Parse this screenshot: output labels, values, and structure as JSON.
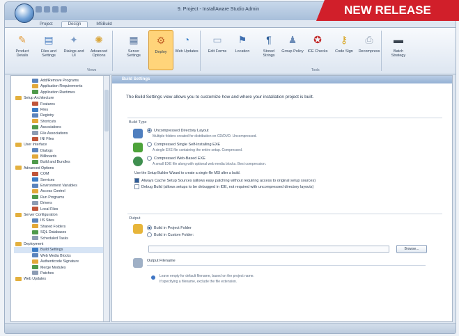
{
  "banner": {
    "bold": "NEW",
    "rest": " RELEASE"
  },
  "window": {
    "title": "9. Project - InstallAware Studio Admin"
  },
  "ribbon_tabs": [
    "Project",
    "Design",
    "MSBuild"
  ],
  "ribbon": {
    "buttons": [
      {
        "label": "Product Details",
        "icon": "product-details-icon",
        "color": "#e39b3a"
      },
      {
        "label": "Files and Settings",
        "icon": "files-icon",
        "color": "#4c7fc0"
      },
      {
        "label": "Dialogs and UI",
        "icon": "dialogs-icon",
        "color": "#7c9cc6"
      },
      {
        "label": "Advanced Options",
        "icon": "advanced-icon",
        "color": "#d9a53a"
      },
      {
        "label": "Server Settings",
        "icon": "server-icon",
        "color": "#5d7aa3"
      },
      {
        "label": "Deploy",
        "icon": "deploy-icon",
        "color": "#c4642a",
        "active": true
      },
      {
        "label": "Web Updates",
        "icon": "web-updates-icon",
        "color": "#3b80c8"
      },
      {
        "label": "Edit Forms",
        "icon": "edit-forms-icon",
        "color": "#8aa2c2"
      },
      {
        "label": "Location",
        "icon": "location-icon",
        "color": "#3f6fb0"
      },
      {
        "label": "Stored Strings",
        "icon": "strings-icon",
        "color": "#2e5f99"
      },
      {
        "label": "Group Policy",
        "icon": "group-policy-icon",
        "color": "#6b8bb7"
      },
      {
        "label": "ICE Checks",
        "icon": "ice-checks-icon",
        "color": "#c22c2c"
      },
      {
        "label": "Code Sign",
        "icon": "code-sign-icon",
        "color": "#d7a21c"
      },
      {
        "label": "Decompress",
        "icon": "decompress-icon",
        "color": "#9aa7b8"
      },
      {
        "label": "Batch Strategy",
        "icon": "batch-icon",
        "color": "#3a4450"
      }
    ],
    "groups": [
      "Views",
      "Tools"
    ]
  },
  "tree": [
    "Add/Remove Programs",
    "Application Requirements",
    "Application Runtimes",
    "Setup Architecture",
    "Features",
    "Files",
    "Registry",
    "Shortcuts",
    "Associations",
    "File Associations",
    "INI Files",
    "User Interface",
    "Dialogs",
    "Billboards",
    "Build and Bundles",
    "Advanced Options",
    "COM",
    "Services",
    "Environment Variables",
    "Access Control",
    "Run Programs",
    "Drivers",
    "Local Files",
    "Server Configuration",
    "IIS Sites",
    "Shared Folders",
    "SQL Databases",
    "Scheduled Tasks",
    "Deployment",
    "Build Settings",
    "Web Media Blocks",
    "Authenticode Signature",
    "Merge Modules",
    "Patches",
    "Web Updates"
  ],
  "main": {
    "header": "Build Settings",
    "intro": "The Build Settings view allows you to customize how and where your installation project is built.",
    "build_type_label": "Build Type",
    "options": [
      {
        "label": "Uncompressed Directory Layout",
        "desc": "Multiple folders created for distribution on CD/DVD. Uncompressed.",
        "on": true
      },
      {
        "label": "Compressed Single Self-Installing EXE",
        "desc": "A single EXE file containing the entire setup. Compressed.",
        "on": false
      },
      {
        "label": "Compressed Web-Based EXE",
        "desc": "A small EXE file along with optional web media blocks. Best compression.",
        "on": false
      }
    ],
    "wizard_text": "Use the Setup Builder Wizard to create a single file MSI after a build.",
    "checks": [
      {
        "label": "Always Cache Setup Sources (allows easy patching without requiring access to original setup sources)",
        "on": true
      },
      {
        "label": "Debug Build (allows setups to be debugged in IDE, not required with uncompressed directory layouts)",
        "on": false
      }
    ],
    "output_label": "Output",
    "folder_options": [
      {
        "label": "Build in Project Folder",
        "on": true
      },
      {
        "label": "Build in Custom Folder:",
        "on": false
      }
    ],
    "browse_label": "Browse...",
    "filename_label": "Output Filename",
    "filename_desc1": "Leave empty for default filename, based on the project name.",
    "filename_desc2": "If specifying a filename, exclude the file extension."
  }
}
